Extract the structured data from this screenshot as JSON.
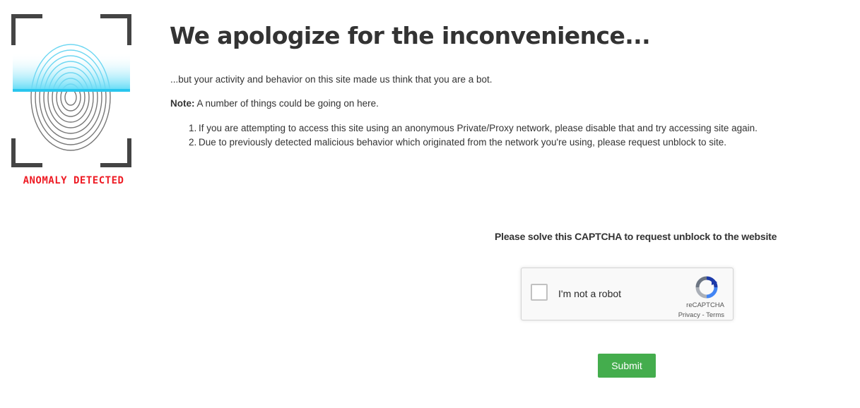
{
  "logo": {
    "caption": "ANOMALY DETECTED",
    "caption_color": "#ee1b24",
    "icon": "fingerprint-scan-icon"
  },
  "main": {
    "title": "We apologize for the inconvenience...",
    "intro": "...but your activity and behavior on this site made us think that you are a bot.",
    "note_label": "Note:",
    "note_text": " A number of things could be going on here.",
    "reasons": [
      {
        "num": "1.",
        "text": "If you are attempting to access this site using an anonymous Private/Proxy network, please disable that and try accessing site again."
      },
      {
        "num": "2.",
        "text": "Due to previously detected malicious behavior which originated from the network you're using, please request unblock to site."
      }
    ]
  },
  "captcha": {
    "prompt": "Please solve this CAPTCHA to request unblock to the website",
    "checkbox_label": "I'm not a robot",
    "brand": "reCAPTCHA",
    "privacy": "Privacy",
    "separator": " - ",
    "terms": "Terms",
    "logo_icon": "recaptcha-logo-icon"
  },
  "form": {
    "submit_label": "Submit",
    "submit_color": "#44ad4d"
  }
}
